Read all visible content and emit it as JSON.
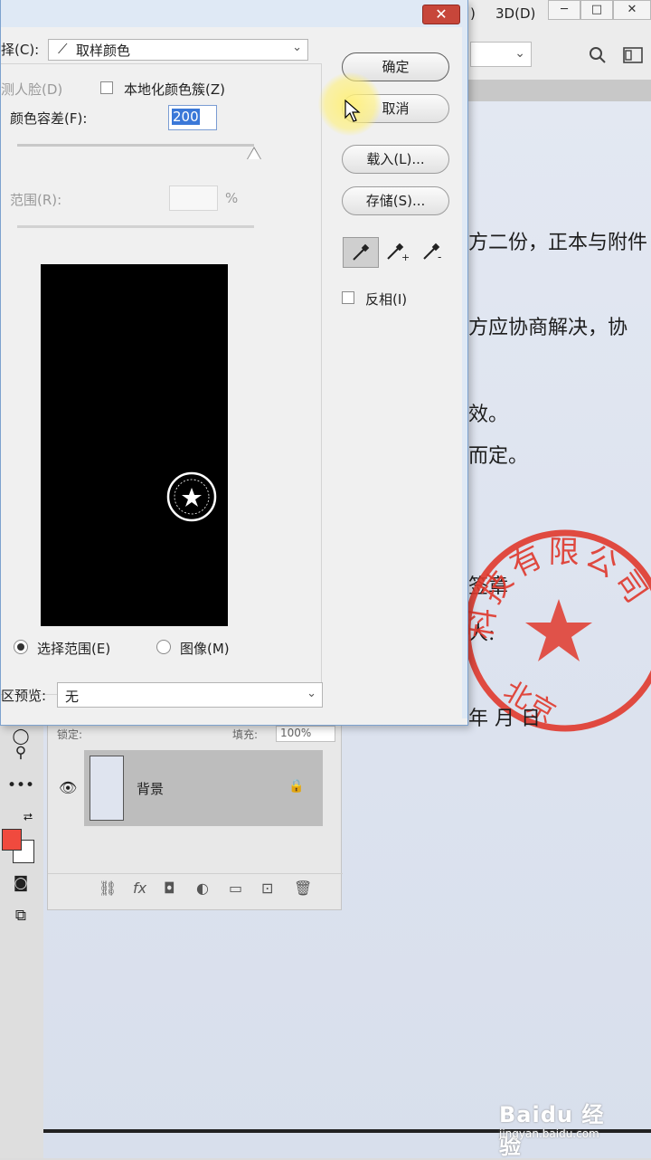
{
  "app": {
    "menu": {
      "partial_item": ")",
      "item_3d": "3D(D)"
    },
    "window_buttons": {
      "minimize": "─",
      "maximize": "□",
      "close": "✕"
    }
  },
  "document": {
    "lines": [
      "方二份，正本与附件",
      "方应协商解决，协",
      "效。",
      "而定。",
      "签章",
      "人:",
      "年    月    日"
    ],
    "seal_text": "科技有限公司",
    "seal_partial": "北京",
    "seal_color": "#e0382c"
  },
  "layers": {
    "lock_label": "锁定:",
    "fill_label": "填充:",
    "fill_value": "100%",
    "layer_name": "背景"
  },
  "dialog": {
    "select_label": "择(C):",
    "select_value": "取样颜色",
    "detect_faces_label": "测人脸(D)",
    "localized_label": "本地化颜色簇(Z)",
    "fuzziness_label": "颜色容差(F):",
    "fuzziness_value": "200",
    "fuzziness_level": 1.0,
    "range_label": "范围(R):",
    "range_unit": "%",
    "selection_radio": "选择范围(E)",
    "image_radio": "图像(M)",
    "preview_label": "区预览:",
    "preview_value": "无",
    "ok_button": "确定",
    "cancel_button": "取消",
    "load_button": "载入(L)...",
    "save_button": "存储(S)...",
    "invert_label": "反相(I)",
    "close_symbol": "✕"
  },
  "watermark": {
    "brand": "Baidu 经验",
    "url": "jingyan.baidu.com"
  },
  "colors": {
    "foreground": "#f04a3e",
    "background": "#ffffff",
    "highlight": "#3a78d8"
  }
}
